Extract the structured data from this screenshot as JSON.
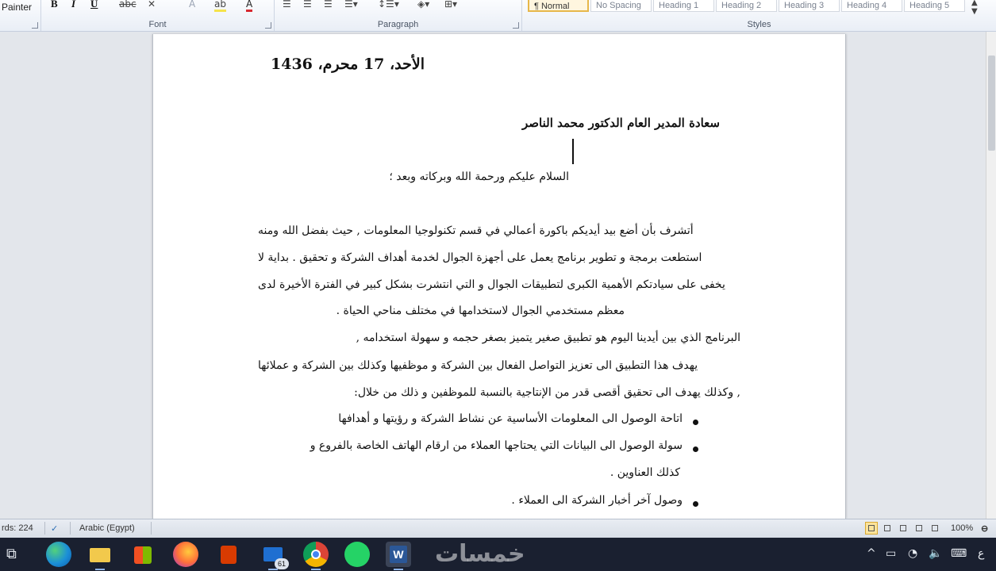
{
  "ribbon": {
    "clipboard": {
      "format_painter": "Painter"
    },
    "font": {
      "label": "Font",
      "buttons": [
        "B",
        "I",
        "U"
      ]
    },
    "paragraph": {
      "label": "Paragraph"
    },
    "styles": {
      "label": "Styles",
      "items": [
        "¶ Normal",
        "No Spacing",
        "Heading 1",
        "Heading 2",
        "Heading 3",
        "Heading 4",
        "Heading 5"
      ]
    }
  },
  "document": {
    "date": "الأحد، 17 محرم، 1436",
    "recipient": "سعادة المدير العام الدكتور محمد الناصر",
    "greeting": "السلام عليكم ورحمة الله وبركاته وبعد ؛",
    "lines": [
      "أتشرف بأن أضع بيد أيديكم باكورة أعمالي في قسم تكنولوجيا المعلومات , حيث بفضل الله ومنه",
      "استطعت برمجة و تطوير برنامج يعمل على أجهزة الجوال لخدمة أهداف الشركة و تحقيق . بداية لا",
      "يخفى على سيادتكم الأهمية الكبرى لتطبيقات الجوال و التي انتشرت بشكل كبير في الفترة الأخيرة لدى",
      "معظم مستخدمي الجوال لاستخدامها في مختلف مناحي الحياة .",
      "البرنامج الذي بين أيدينا اليوم هو تطبيق صغير يتميز بصغر حجمه و سهولة استخدامه ,",
      "يهدف هذا التطبيق الى تعزيز التواصل الفعال بين الشركة و موظفيها وكذلك بين الشركة و عملائها",
      ", وكذلك يهدف الى تحقيق أقصى قدر من الإنتاجية بالنسبة للموظفين و ذلك من خلال:"
    ],
    "bullets": [
      "اتاحة الوصول الى المعلومات الأساسية عن نشاط الشركة و رؤيتها و أهدافها",
      "سولة الوصول الى البيانات التي يحتاجها العملاء من ارقام الهاتف الخاصة بالفروع و",
      "وصول آخر أخبار الشركة الى العملاء ."
    ],
    "bullet_continuation": "كذلك العناوين ."
  },
  "status_bar": {
    "words": "rds: 224",
    "language": "Arabic (Egypt)",
    "zoom": "100%"
  },
  "taskbar": {
    "mail_badge": "61",
    "watermark": "خمسات",
    "lang_indicator": "ع"
  }
}
